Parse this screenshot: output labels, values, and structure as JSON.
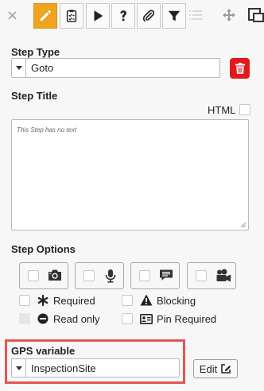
{
  "toolbar": {
    "close": "×",
    "tools": [
      {
        "icon": "pencil-icon",
        "active": true
      },
      {
        "icon": "clipboard-icon",
        "active": false
      },
      {
        "icon": "play-icon",
        "active": false
      },
      {
        "icon": "question-icon",
        "active": false
      },
      {
        "icon": "paperclip-icon",
        "active": false
      },
      {
        "icon": "filter-icon",
        "active": false
      }
    ]
  },
  "step_type": {
    "label": "Step Type",
    "value": "Goto"
  },
  "step_title": {
    "label": "Step Title",
    "html_label": "HTML",
    "placeholder": "This Step has no text"
  },
  "step_options": {
    "label": "Step Options",
    "toggles": [
      {
        "icon": "camera-icon",
        "checked": false
      },
      {
        "icon": "microphone-icon",
        "checked": false
      },
      {
        "icon": "comment-icon",
        "checked": false
      },
      {
        "icon": "video-camera-icon",
        "checked": false
      }
    ],
    "checks": {
      "required": "Required",
      "read_only": "Read only",
      "blocking": "Blocking",
      "pin_required": "Pin Required"
    }
  },
  "gps": {
    "label": "GPS variable",
    "value": "InspectionSite",
    "edit_label": "Edit"
  },
  "colors": {
    "accent": "#f0a31e",
    "danger": "#e4191e",
    "highlight": "#e45552"
  }
}
